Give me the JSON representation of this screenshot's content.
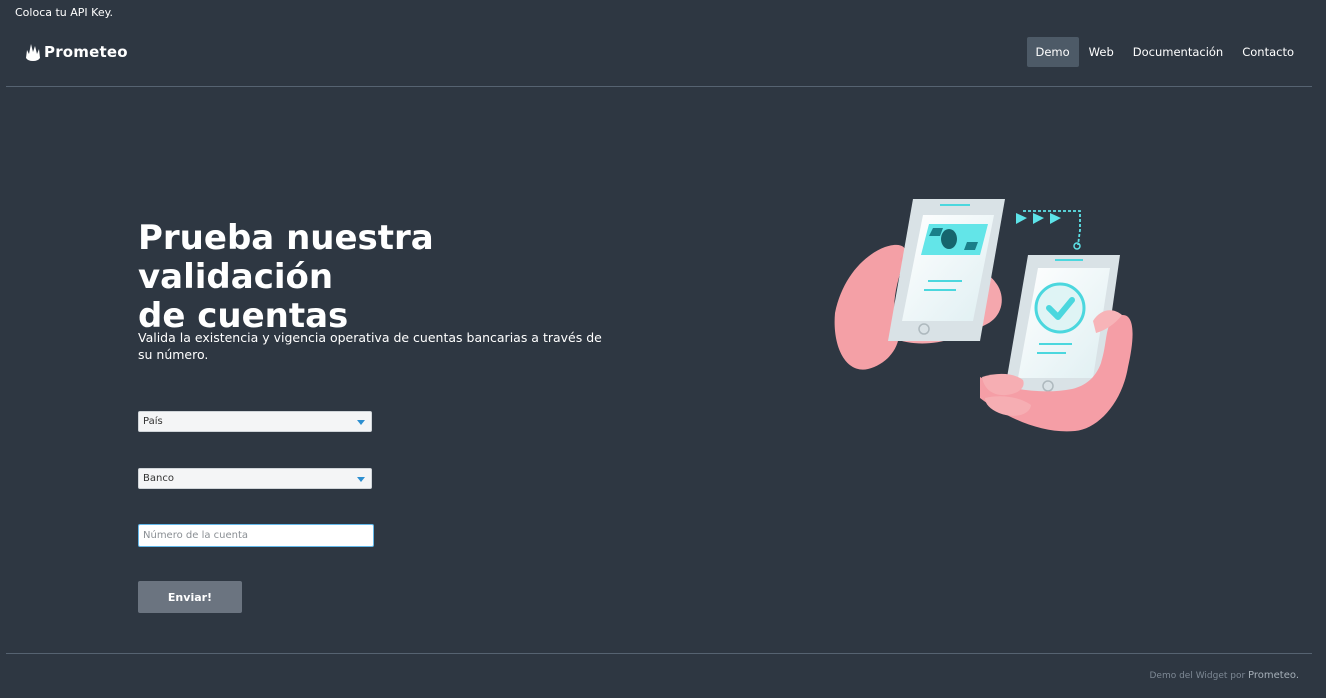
{
  "header": {
    "api_key_note": "Coloca tu API Key.",
    "brand": "Prometeo",
    "nav": [
      {
        "label": "Demo",
        "active": true
      },
      {
        "label": "Web",
        "active": false
      },
      {
        "label": "Documentación",
        "active": false
      },
      {
        "label": "Contacto",
        "active": false
      }
    ]
  },
  "hero": {
    "title_line_1": "Prueba nuestra validación",
    "title_line_2": "de cuentas",
    "description": "Valida la existencia y vigencia operativa de cuentas bancarias a través de su número."
  },
  "form": {
    "country_select": {
      "value": "País",
      "icon": "chevron-down-icon"
    },
    "bank_select": {
      "value": "Banco",
      "icon": "chevron-down-icon"
    },
    "account_input": {
      "value": "",
      "placeholder": "Número de la cuenta"
    },
    "submit_label": "Enviar!"
  },
  "footer": {
    "prefix": "Demo del Widget por ",
    "brand": "Prometeo."
  },
  "colors": {
    "background": "#2e3742",
    "active_nav": "#4d5a67",
    "button": "#6b7480",
    "input_focus": "#63b8ea",
    "illustration_accent": "#5de3e8",
    "hands": "#f5a2a8"
  },
  "illustration": {
    "icon": "bank-transfer-illustration"
  }
}
